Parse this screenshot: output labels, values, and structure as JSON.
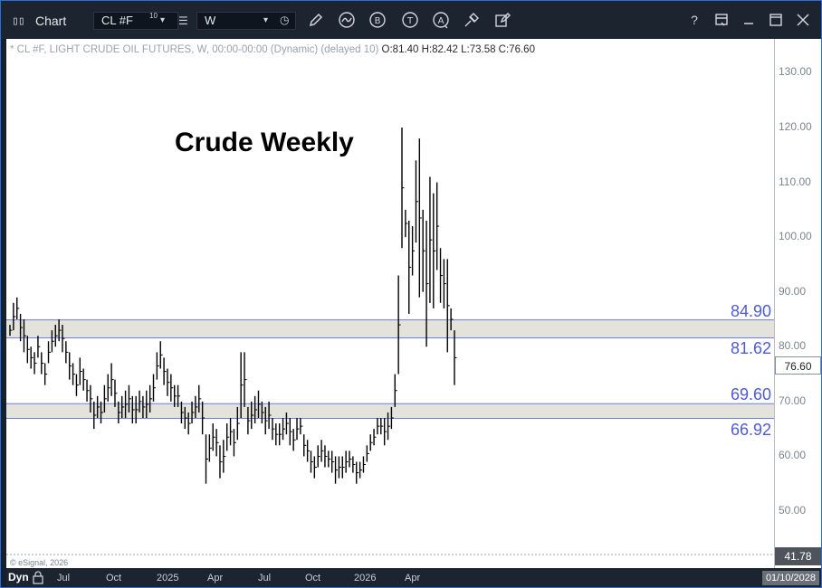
{
  "toolbar": {
    "title": "Chart",
    "symbol": "CL #F",
    "symbol_superscript": "10",
    "interval": "W",
    "icons": [
      "grid-icon",
      "list-icon",
      "clock-icon",
      "pencil-icon",
      "wave-icon",
      "letter-b-icon",
      "letter-t-icon",
      "letter-a-icon",
      "settings-icon",
      "edit-icon",
      "help-icon",
      "panel-icon",
      "minimize-icon",
      "maximize-icon",
      "close-icon"
    ],
    "help_label": "?"
  },
  "legend": {
    "description": "* CL #F, LIGHT CRUDE OIL FUTURES, W, 00:00-00:00 (Dynamic) (delayed 10)",
    "ohlc": "O:81.40 H:82.42 L:73.58 C:76.60"
  },
  "annotation_title": "Crude Weekly",
  "copyright": "© eSignal, 2026",
  "x_axis": {
    "mode": "Dyn",
    "ticks": [
      "Jul",
      "Oct",
      "2025",
      "Apr",
      "Jul",
      "Oct",
      "2026",
      "Apr"
    ],
    "date": "01/10/2028"
  },
  "y_axis": {
    "ticks": [
      "130.00",
      "120.00",
      "110.00",
      "100.00",
      "90.00",
      "80.00",
      "70.00",
      "60.00",
      "50.00"
    ],
    "last_price": "76.60",
    "low_value": "41.78"
  },
  "colors": {
    "zone_fill": "#e3e3dc",
    "zone_line": "#6f7de0",
    "zone_label": "#4d5bd6",
    "bar": "#000000"
  },
  "chart_data": {
    "type": "ohlc",
    "title": "Crude Weekly",
    "xlabel": "",
    "ylabel": "",
    "ylim": [
      40,
      135
    ],
    "grid": false,
    "zones": [
      {
        "low": 81.62,
        "high": 84.9,
        "low_label": "81.62",
        "high_label": "84.90"
      },
      {
        "low": 66.92,
        "high": 69.6,
        "low_label": "66.92",
        "high_label": "69.60"
      }
    ],
    "series": [
      {
        "values": [
          [
            82,
            84
          ],
          [
            83,
            88
          ],
          [
            85,
            89
          ],
          [
            81,
            86
          ],
          [
            79,
            85
          ],
          [
            77,
            82
          ],
          [
            76,
            80
          ],
          [
            75,
            79
          ],
          [
            78,
            82
          ],
          [
            75,
            79
          ],
          [
            73,
            77
          ],
          [
            77,
            81
          ],
          [
            79,
            83
          ],
          [
            80,
            84
          ],
          [
            81,
            85
          ],
          [
            79,
            84
          ],
          [
            77,
            81
          ],
          [
            74,
            79
          ],
          [
            73,
            77
          ],
          [
            71,
            75
          ],
          [
            73,
            78
          ],
          [
            72,
            76
          ],
          [
            70,
            74
          ],
          [
            68,
            73
          ],
          [
            65,
            70
          ],
          [
            67,
            71
          ],
          [
            66,
            70
          ],
          [
            68,
            73
          ],
          [
            70,
            75
          ],
          [
            71,
            77
          ],
          [
            69,
            74
          ],
          [
            66,
            70
          ],
          [
            67,
            71
          ],
          [
            67,
            72
          ],
          [
            68,
            73
          ],
          [
            66,
            71
          ],
          [
            66,
            71
          ],
          [
            68,
            72
          ],
          [
            67,
            71
          ],
          [
            67,
            72
          ],
          [
            68,
            73
          ],
          [
            70,
            75
          ],
          [
            74,
            79
          ],
          [
            76,
            81
          ],
          [
            73,
            78
          ],
          [
            71,
            76
          ],
          [
            70,
            75
          ],
          [
            69,
            73
          ],
          [
            69,
            73
          ],
          [
            66,
            70
          ],
          [
            65,
            69
          ],
          [
            64,
            68
          ],
          [
            66,
            70
          ],
          [
            67,
            71
          ],
          [
            68,
            73
          ],
          [
            64,
            70
          ],
          [
            55,
            64
          ],
          [
            59,
            64
          ],
          [
            61,
            66
          ],
          [
            60,
            65
          ],
          [
            56,
            62
          ],
          [
            57,
            63
          ],
          [
            61,
            66
          ],
          [
            62,
            67
          ],
          [
            60,
            65
          ],
          [
            63,
            69
          ],
          [
            67,
            79
          ],
          [
            69,
            79
          ],
          [
            64,
            69
          ],
          [
            65,
            70
          ],
          [
            66,
            71
          ],
          [
            67,
            72
          ],
          [
            66,
            70
          ],
          [
            64,
            69
          ],
          [
            65,
            70
          ],
          [
            63,
            67
          ],
          [
            62,
            66
          ],
          [
            62,
            66
          ],
          [
            63,
            67
          ],
          [
            64,
            68
          ],
          [
            62,
            67
          ],
          [
            61,
            65
          ],
          [
            63,
            67
          ],
          [
            64,
            67
          ],
          [
            60,
            64
          ],
          [
            59,
            63
          ],
          [
            57,
            61
          ],
          [
            56,
            60
          ],
          [
            58,
            62
          ],
          [
            59,
            63
          ],
          [
            58,
            62
          ],
          [
            58,
            61
          ],
          [
            57,
            61
          ],
          [
            55,
            60
          ],
          [
            56,
            60
          ],
          [
            56,
            60
          ],
          [
            57,
            61
          ],
          [
            58,
            61
          ],
          [
            57,
            60
          ],
          [
            55,
            59
          ],
          [
            56,
            59
          ],
          [
            57,
            60
          ],
          [
            59,
            62
          ],
          [
            61,
            64
          ],
          [
            62,
            65
          ],
          [
            64,
            67
          ],
          [
            64,
            67
          ],
          [
            62,
            67
          ],
          [
            63,
            68
          ],
          [
            65,
            69
          ],
          [
            69,
            75
          ],
          [
            75,
            93
          ],
          [
            98,
            120
          ],
          [
            100,
            105
          ],
          [
            86,
            103
          ],
          [
            93,
            102
          ],
          [
            99,
            114
          ],
          [
            89,
            118
          ],
          [
            90,
            105
          ],
          [
            80,
            103
          ],
          [
            88,
            111
          ],
          [
            87,
            108
          ],
          [
            94,
            110
          ],
          [
            88,
            98
          ],
          [
            87,
            96
          ],
          [
            79,
            96
          ],
          [
            83,
            87
          ],
          [
            73,
            83
          ]
        ]
      }
    ]
  }
}
